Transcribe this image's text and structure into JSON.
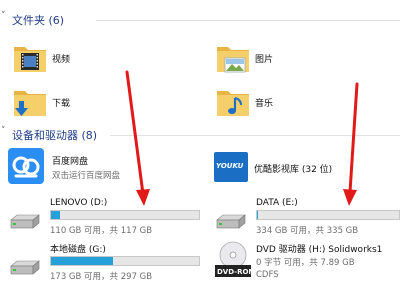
{
  "sections": {
    "folders": {
      "title": "文件夹 (6)"
    },
    "devices": {
      "title": "设备和驱动器 (8)"
    }
  },
  "folders": [
    {
      "label": "视频",
      "icon": "video-folder-icon"
    },
    {
      "label": "图片",
      "icon": "pictures-folder-icon"
    },
    {
      "label": "下载",
      "icon": "downloads-folder-icon"
    },
    {
      "label": "音乐",
      "icon": "music-folder-icon"
    }
  ],
  "apps": [
    {
      "name": "百度网盘",
      "desc": "双击运行百度网盘",
      "icon": "baidu-netdisk-icon"
    },
    {
      "name": "优酷影视库 (32 位)",
      "icon": "youku-icon",
      "logo_text": "YOUKU"
    }
  ],
  "drives": [
    {
      "name": "LENOVO (D:)",
      "space": "110 GB 可用，共 117 GB",
      "used_fraction": 0.06
    },
    {
      "name": "DATA (E:)",
      "space": "334 GB 可用，共 335 GB",
      "used_fraction": 0.01
    },
    {
      "name": "本地磁盘 (G:)",
      "space": "173 GB 可用，共 297 GB",
      "used_fraction": 0.42
    }
  ],
  "dvd": {
    "name": "DVD 驱动器 (H:) Solidworks1",
    "space": "0 字节 可用，共 7.89 GB",
    "fs": "CDFS",
    "disc_label": "DVD-ROM"
  },
  "colors": {
    "accent": "#26a0da",
    "folder": "#f2c55c",
    "arrow": "#e11919",
    "section_title": "#1f3d8a"
  }
}
